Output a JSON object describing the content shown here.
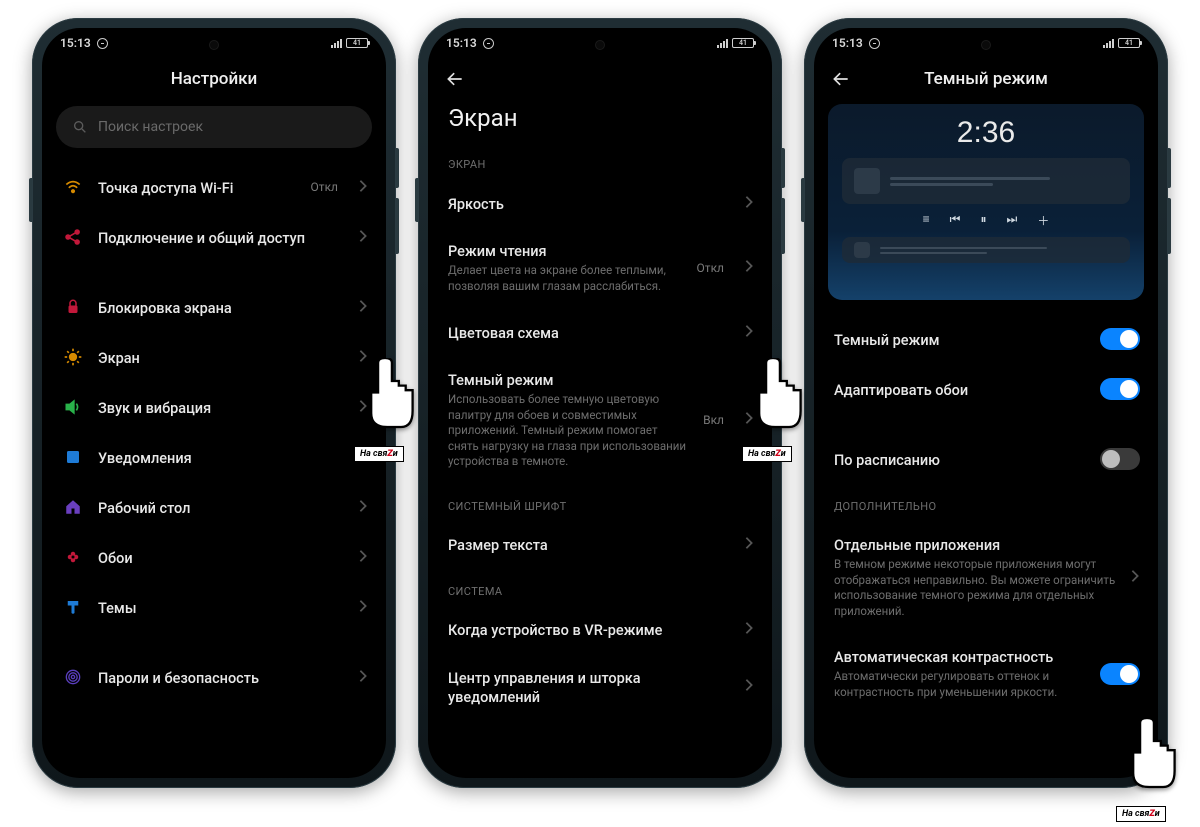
{
  "status": {
    "time": "15:13",
    "battery": "41"
  },
  "cursor_tag_plain": "На свя",
  "cursor_tag_accent": "Z",
  "cursor_tag_tail": "и",
  "screen1": {
    "title": "Настройки",
    "search_placeholder": "Поиск настроек",
    "rows": [
      {
        "id": "wifi-hotspot",
        "label": "Точка доступа Wi-Fi",
        "value": "Откл",
        "icon": "wifi",
        "color": "#d68a00"
      },
      {
        "id": "connection-sharing",
        "label": "Подключение и общий доступ",
        "icon": "share",
        "color": "#c2183a"
      }
    ],
    "rows2": [
      {
        "id": "lock-screen",
        "label": "Блокировка экрана",
        "icon": "lock",
        "color": "#c2183a"
      },
      {
        "id": "display",
        "label": "Экран",
        "icon": "sun",
        "color": "#d68a00"
      },
      {
        "id": "sound",
        "label": "Звук и вибрация",
        "icon": "volume",
        "color": "#29b24a"
      },
      {
        "id": "notifications",
        "label": "Уведомления",
        "icon": "square",
        "color": "#1e7bd6"
      },
      {
        "id": "home-screen",
        "label": "Рабочий стол",
        "icon": "home",
        "color": "#6a3fbf"
      },
      {
        "id": "wallpaper",
        "label": "Обои",
        "icon": "flower",
        "color": "#c2183a"
      },
      {
        "id": "themes",
        "label": "Темы",
        "icon": "brush",
        "color": "#1e7bd6"
      }
    ],
    "rows3": [
      {
        "id": "security",
        "label": "Пароли и безопасность",
        "icon": "fingerprint",
        "color": "#5a3fbf"
      }
    ]
  },
  "screen2": {
    "back": true,
    "title": "Экран",
    "sections": [
      {
        "label": "ЭКРАН",
        "rows": [
          {
            "id": "brightness",
            "label": "Яркость"
          },
          {
            "id": "reading-mode",
            "label": "Режим чтения",
            "sub": "Делает цвета на экране более теплыми, позволяя вашим глазам расслабиться.",
            "value": "Откл"
          },
          {
            "id": "color-scheme",
            "label": "Цветовая схема"
          },
          {
            "id": "dark-mode",
            "label": "Темный режим",
            "sub": "Использовать более темную цветовую палитру для обоев и совместимых приложений. Темный режим помогает снять нагрузку на глаза при использовании устройства в темноте.",
            "value": "Вкл"
          }
        ]
      },
      {
        "label": "СИСТЕМНЫЙ ШРИФТ",
        "rows": [
          {
            "id": "text-size",
            "label": "Размер текста"
          }
        ]
      },
      {
        "label": "СИСТЕМА",
        "rows": [
          {
            "id": "vr-mode",
            "label": "Когда устройство в VR-режиме"
          },
          {
            "id": "control-center",
            "label": "Центр управления и шторка уведомлений"
          }
        ]
      }
    ]
  },
  "screen3": {
    "back": true,
    "title": "Темный режим",
    "preview_clock": "2:36",
    "toggles": [
      {
        "id": "dark-mode-toggle",
        "label": "Темный режим",
        "on": true
      },
      {
        "id": "adapt-wallpaper",
        "label": "Адаптировать обои",
        "on": true
      }
    ],
    "toggles2": [
      {
        "id": "schedule",
        "label": "По расписанию",
        "on": false
      }
    ],
    "extra_label": "ДОПОЛНИТЕЛЬНО",
    "extra_rows": [
      {
        "id": "individual-apps",
        "label": "Отдельные приложения",
        "sub": "В темном режиме некоторые приложения могут отображаться неправильно. Вы можете ограничить использование темного режима для отдельных приложений."
      },
      {
        "id": "auto-contrast",
        "label": "Автоматическая контрастность",
        "sub": "Автоматически регулировать оттенок и контрастность при уменьшении яркости.",
        "toggle": true,
        "on": true
      }
    ]
  }
}
